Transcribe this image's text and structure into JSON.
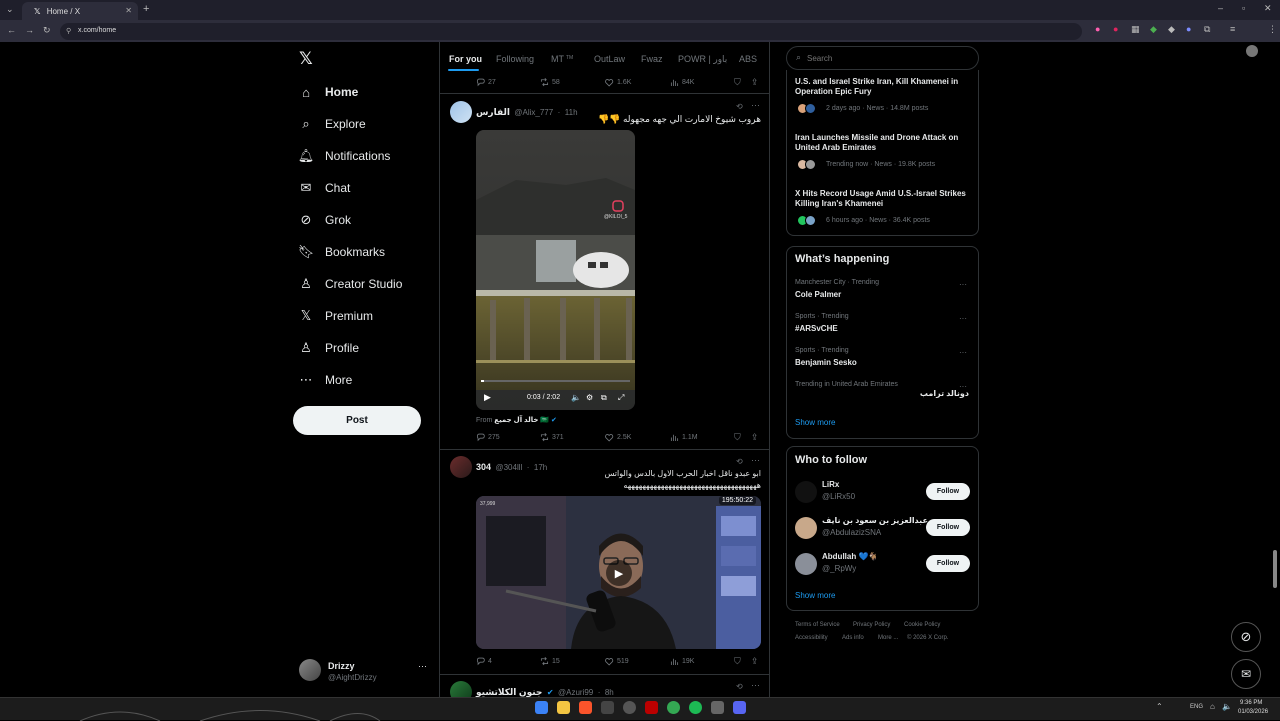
{
  "browser": {
    "tab_title": "Home / X",
    "url": "x.com/home"
  },
  "nav": {
    "items": [
      {
        "label": "Home",
        "icon": "home-icon"
      },
      {
        "label": "Explore",
        "icon": "search-icon"
      },
      {
        "label": "Notifications",
        "icon": "bell-icon"
      },
      {
        "label": "Chat",
        "icon": "mail-icon"
      },
      {
        "label": "Grok",
        "icon": "grok-icon"
      },
      {
        "label": "Bookmarks",
        "icon": "bookmark-icon"
      },
      {
        "label": "Creator Studio",
        "icon": "creator-icon"
      },
      {
        "label": "Premium",
        "icon": "x-logo-icon"
      },
      {
        "label": "Profile",
        "icon": "person-icon"
      },
      {
        "label": "More",
        "icon": "more-circle-icon"
      }
    ],
    "post_label": "Post",
    "account": {
      "name": "Drizzy",
      "handle": "@AightDrizzy"
    }
  },
  "timeline": {
    "tabs": [
      "For you",
      "Following",
      "MT",
      "OutLaw",
      "Fwaz",
      "POWR | باور",
      "ABS"
    ],
    "tab_mt_badge": "TM",
    "prev_actions": {
      "replies": "27",
      "reposts": "58",
      "likes": "1.6K",
      "views": "84K"
    },
    "tweets": [
      {
        "name": "الفارس",
        "handle": "@Alix_777",
        "time": "11h",
        "text": "هروب شيوخ الامارت الي جهه مجهوله 👎👎",
        "video_time": "0:03 / 2:02",
        "video_watermark": "@KILOI_5",
        "from_label": "From",
        "from_name": "خالد آل جميع 🇸🇦",
        "actions": {
          "replies": "275",
          "reposts": "371",
          "likes": "2.5K",
          "views": "1.1M"
        }
      },
      {
        "name": "304",
        "handle": "@304lll",
        "time": "17h",
        "text1": "ابو عبدو ناقل اخبار الحرب الاول بالدس والواتس",
        "text2": "ههههههههههههههههههههههههههههههههههههه",
        "video_duration": "195:50:22",
        "video_count": "37,999",
        "actions": {
          "replies": "4",
          "reposts": "15",
          "likes": "519",
          "views": "19K"
        }
      },
      {
        "name": "جنون الكلاتشيو",
        "handle": "@Azuri99",
        "time": "8h"
      }
    ]
  },
  "search": {
    "placeholder": "Search"
  },
  "news": [
    {
      "title": "U.S. and Israel Strike Iran, Kill Khamenei in Operation Epic Fury",
      "meta": "2 days ago · News · 14.8M posts"
    },
    {
      "title": "Iran Launches Missile and Drone Attack on United Arab Emirates",
      "meta": "Trending now · News · 19.8K posts"
    },
    {
      "title": "X Hits Record Usage Amid U.S.-Israel Strikes Killing Iran's Khamenei",
      "meta": "6 hours ago · News · 36.4K posts"
    }
  ],
  "whats_happening": {
    "title": "What’s happening",
    "trends": [
      {
        "category": "Manchester City · Trending",
        "name": "Cole Palmer"
      },
      {
        "category": "Sports · Trending",
        "name": "#ARSvCHE"
      },
      {
        "category": "Sports · Trending",
        "name": "Benjamin Sesko"
      },
      {
        "category": "Trending in United Arab Emirates",
        "name": "دونالد ترامب"
      }
    ],
    "show_more": "Show more"
  },
  "who_to_follow": {
    "title": "Who to follow",
    "users": [
      {
        "name": "LiRx",
        "handle": "@LiRx50"
      },
      {
        "name": "عبدالعزيز بن سعود بن نايف...",
        "handle": "@AbdulazizSNA"
      },
      {
        "name": "Abdullah 💙🐐",
        "handle": "@_RpWy"
      }
    ],
    "follow_label": "Follow",
    "show_more": "Show more"
  },
  "footer": {
    "links": [
      "Terms of Service",
      "Privacy Policy",
      "Cookie Policy",
      "Accessibility",
      "Ads info",
      "More ...",
      "© 2026 X Corp."
    ]
  },
  "taskbar": {
    "time": "9:36 PM",
    "date": "01/03/2026",
    "lang": "ENG"
  },
  "colors": {
    "accent": "#1d9bf0",
    "bg": "#000000",
    "border": "#2f3336",
    "muted": "#71767b"
  }
}
